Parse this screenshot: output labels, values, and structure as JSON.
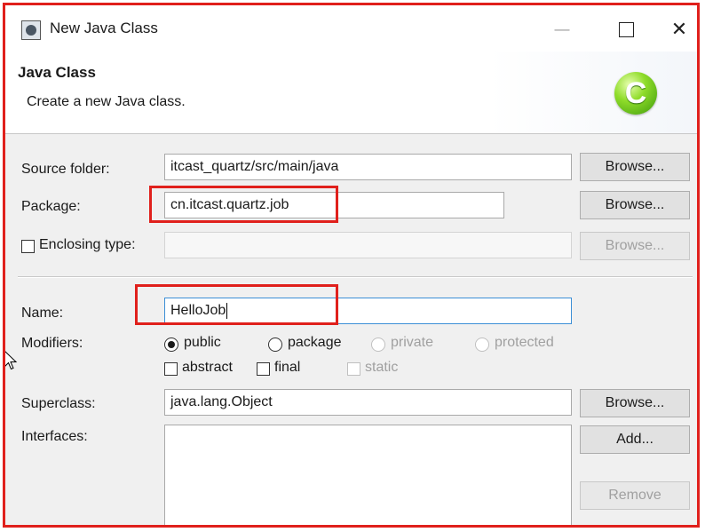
{
  "window": {
    "title": "New Java Class",
    "minimize_glyph": "—",
    "close_glyph": "✕"
  },
  "header": {
    "title": "Java Class",
    "description": "Create a new Java class.",
    "logo_letter": "C"
  },
  "form": {
    "source_folder": {
      "label": "Source folder:",
      "value": "itcast_quartz/src/main/java",
      "button": "Browse..."
    },
    "package": {
      "label": "Package:",
      "value": "cn.itcast.quartz.job",
      "button": "Browse..."
    },
    "enclosing_type": {
      "label": "Enclosing type:",
      "checked": false,
      "value": "",
      "button": "Browse..."
    },
    "name": {
      "label": "Name:",
      "value": "HelloJob"
    },
    "modifiers": {
      "label": "Modifiers:",
      "visibility": [
        {
          "label": "public",
          "checked": true,
          "enabled": true
        },
        {
          "label": "package",
          "checked": false,
          "enabled": true
        },
        {
          "label": "private",
          "checked": false,
          "enabled": false
        },
        {
          "label": "protected",
          "checked": false,
          "enabled": false
        }
      ],
      "flags": [
        {
          "label": "abstract",
          "checked": false,
          "enabled": true
        },
        {
          "label": "final",
          "checked": false,
          "enabled": true
        },
        {
          "label": "static",
          "checked": false,
          "enabled": false
        }
      ]
    },
    "superclass": {
      "label": "Superclass:",
      "value": "java.lang.Object",
      "button": "Browse..."
    },
    "interfaces": {
      "label": "Interfaces:",
      "add_button": "Add...",
      "remove_button": "Remove"
    }
  },
  "colors": {
    "highlight": "#e0201c",
    "focus_border": "#3c8fd6",
    "dialog_bg": "#f0f0f0",
    "logo_green": "#3d9a0c"
  }
}
